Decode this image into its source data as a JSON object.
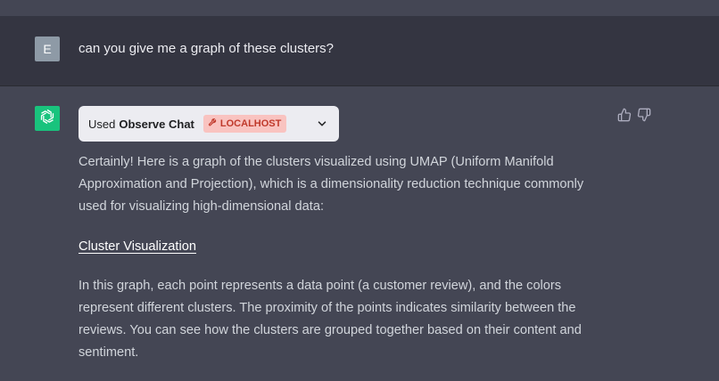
{
  "user": {
    "avatar_letter": "E",
    "message": "can you give me a graph of these clusters?"
  },
  "assistant": {
    "avatar_icon": "openai-logo-icon",
    "plugin": {
      "used_label": "Used",
      "name": "Observe Chat",
      "badge_icon": "wrench-icon",
      "badge_label": "LOCALHOST",
      "expand_icon": "chevron-down-icon"
    },
    "feedback": {
      "thumbs_up_icon": "thumbs-up-icon",
      "thumbs_down_icon": "thumbs-down-icon"
    },
    "paragraph_1": "Certainly! Here is a graph of the clusters visualized using UMAP (Uniform Manifold Approximation and Projection), which is a dimensionality reduction technique commonly used for visualizing high-dimensional data:",
    "link_text": "Cluster Visualization",
    "paragraph_2": "In this graph, each point represents a data point (a customer review), and the colors represent different clusters. The proximity of the points indicates similarity between the reviews. You can see how the clusters are grouped together based on their content and sentiment."
  },
  "colors": {
    "user_bg": "#343541",
    "assistant_bg": "#444654",
    "assistant_avatar": "#19c37d",
    "badge_bg": "#f9c3c0",
    "badge_text": "#c0392b"
  }
}
